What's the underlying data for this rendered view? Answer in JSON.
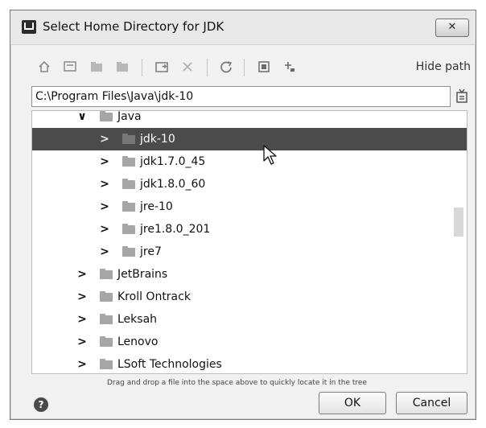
{
  "dialog": {
    "title": "Select Home Directory for JDK",
    "close_glyph": "✕"
  },
  "toolbar": {
    "icons": [
      "home-icon",
      "desktop-icon",
      "project-icon",
      "module-icon",
      "new-folder-icon",
      "delete-icon",
      "refresh-icon",
      "show-hidden-icon",
      "select-file-icon"
    ],
    "hide_path_label": "Hide path"
  },
  "path": {
    "value": "C:\\Program Files\\Java\\jdk-10"
  },
  "tree": {
    "items": [
      {
        "label": "Java",
        "chevron": "∨"
      },
      {
        "label": "jdk-10",
        "chevron": ">"
      },
      {
        "label": "jdk1.7.0_45",
        "chevron": ">"
      },
      {
        "label": "jdk1.8.0_60",
        "chevron": ">"
      },
      {
        "label": "jre-10",
        "chevron": ">"
      },
      {
        "label": "jre1.8.0_201",
        "chevron": ">"
      },
      {
        "label": "jre7",
        "chevron": ">"
      },
      {
        "label": "JetBrains",
        "chevron": ">"
      },
      {
        "label": "Kroll Ontrack",
        "chevron": ">"
      },
      {
        "label": "Leksah",
        "chevron": ">"
      },
      {
        "label": "Lenovo",
        "chevron": ">"
      },
      {
        "label": "LSoft Technologies",
        "chevron": ">"
      }
    ],
    "selected_label": "jdk-10"
  },
  "hint": "Drag and drop a file into the space above to quickly locate it in the tree",
  "footer": {
    "help_glyph": "?",
    "ok_label": "OK",
    "cancel_label": "Cancel"
  }
}
